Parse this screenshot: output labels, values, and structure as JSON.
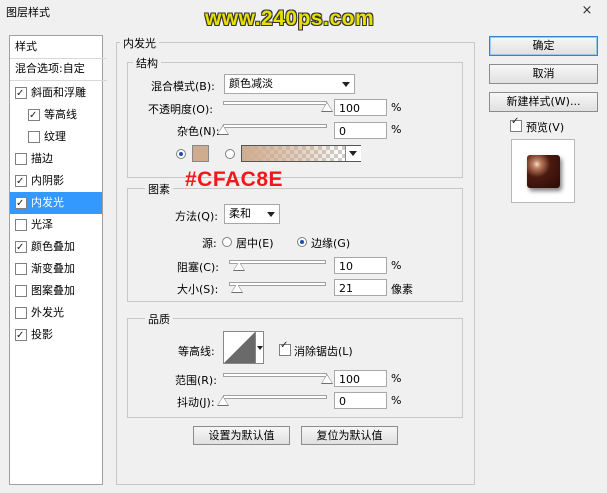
{
  "window": {
    "title": "图层样式",
    "close_icon": "×"
  },
  "watermark": "www.240ps.com",
  "sidebar": {
    "header_styles": "样式",
    "header_blend": "混合选项:自定",
    "items": [
      {
        "label": "斜面和浮雕",
        "checked": true
      },
      {
        "label": "等高线",
        "checked": true
      },
      {
        "label": "纹理",
        "checked": false
      },
      {
        "label": "描边",
        "checked": false
      },
      {
        "label": "内阴影",
        "checked": true
      },
      {
        "label": "内发光",
        "checked": true,
        "selected": true
      },
      {
        "label": "光泽",
        "checked": false
      },
      {
        "label": "颜色叠加",
        "checked": true
      },
      {
        "label": "渐变叠加",
        "checked": false
      },
      {
        "label": "图案叠加",
        "checked": false
      },
      {
        "label": "外发光",
        "checked": false
      },
      {
        "label": "投影",
        "checked": true
      }
    ]
  },
  "panel": {
    "title": "内发光",
    "structure": {
      "title": "结构",
      "blend_mode_label": "混合模式(B):",
      "blend_mode_value": "颜色减淡",
      "opacity_label": "不透明度(O):",
      "opacity_value": "100",
      "opacity_unit": "%",
      "opacity_level": 1.0,
      "noise_label": "杂色(N):",
      "noise_value": "0",
      "noise_unit": "%",
      "noise_level": 0.0,
      "glow_color": "#cfac8e"
    },
    "elements": {
      "title": "图素",
      "method_label": "方法(Q):",
      "method_value": "柔和",
      "source_label": "源:",
      "source_center": "居中(E)",
      "source_edge": "边缘(G)",
      "choke_label": "阻塞(C):",
      "choke_value": "10",
      "choke_unit": "%",
      "choke_level": 0.1,
      "size_label": "大小(S):",
      "size_value": "21",
      "size_unit": "像素",
      "size_level": 0.084
    },
    "quality": {
      "title": "品质",
      "contour_label": "等高线:",
      "antialias_label": "消除锯齿(L)",
      "antialias_checked": true,
      "range_label": "范围(R):",
      "range_value": "100",
      "range_unit": "%",
      "range_level": 1.0,
      "jitter_label": "抖动(J):",
      "jitter_value": "0",
      "jitter_unit": "%",
      "jitter_level": 0.0
    },
    "set_default_button": "设置为默认值",
    "reset_default_button": "复位为默认值"
  },
  "annotation": "#CFAC8E",
  "buttons": {
    "ok": "确定",
    "cancel": "取消",
    "new_style": "新建样式(W)...",
    "preview_label": "预览(V)",
    "preview_checked": true
  },
  "colors": {
    "selection": "#3399ff",
    "annotation_red": "#f01818",
    "watermark_yellow": "#e8e000"
  }
}
